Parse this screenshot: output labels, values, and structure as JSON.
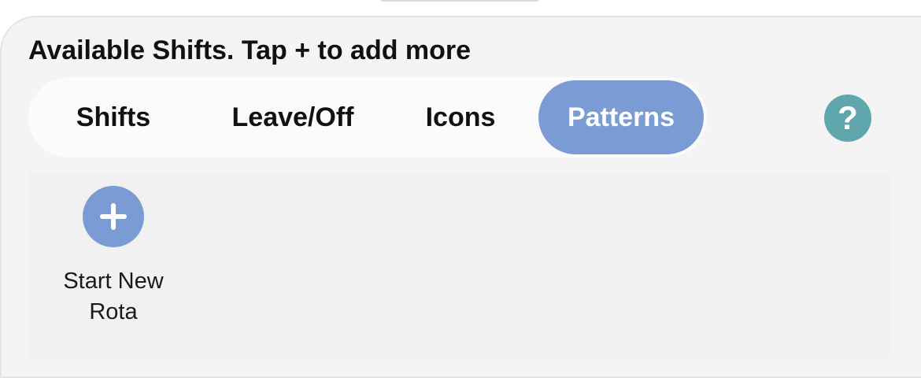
{
  "sheet": {
    "title": "Available Shifts. Tap + to add more"
  },
  "tabs": [
    {
      "label": "Shifts",
      "selected": false
    },
    {
      "label": "Leave/Off",
      "selected": false
    },
    {
      "label": "Icons",
      "selected": false
    },
    {
      "label": "Patterns",
      "selected": true
    }
  ],
  "help": {
    "icon": "question-mark-icon",
    "glyph": "?"
  },
  "patterns": {
    "add_item": {
      "icon": "plus-icon",
      "label_line1": "Start New",
      "label_line2": "Rota"
    }
  },
  "colors": {
    "accent": "#7b9bd4",
    "help": "#5fa7ac",
    "sheet_bg": "#f4f4f4",
    "panel_bg": "#f1f1f1"
  }
}
